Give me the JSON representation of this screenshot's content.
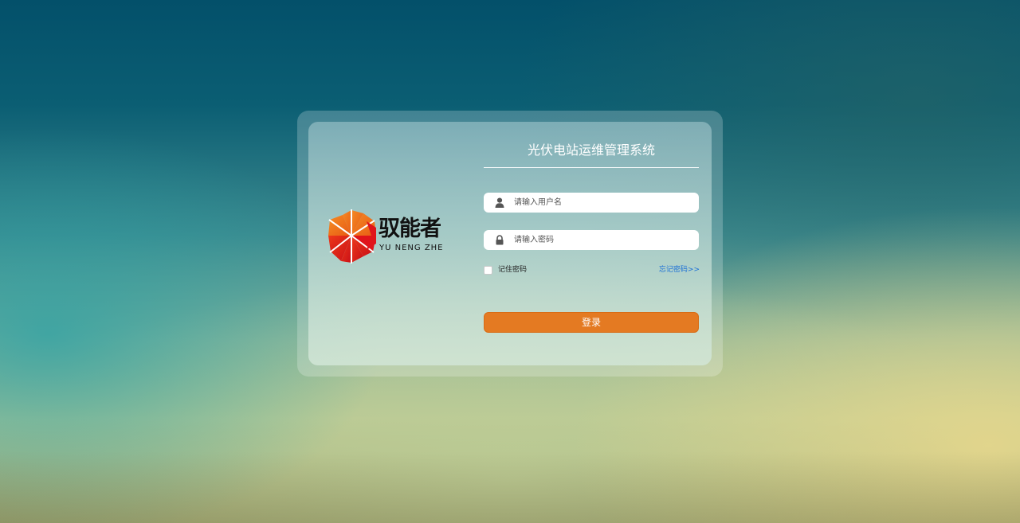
{
  "brand": {
    "name_cn": "驭能者",
    "name_en": "YU NENG ZHE"
  },
  "login": {
    "title": "光伏电站运维管理系统",
    "username": {
      "value": "",
      "placeholder": "请输入用户名",
      "icon": "user-icon"
    },
    "password": {
      "value": "",
      "placeholder": "请输入密码",
      "icon": "lock-icon"
    },
    "remember_label": "记住密码",
    "remember_checked": false,
    "forgot_link": "忘记密码>>",
    "submit_label": "登录"
  },
  "colors": {
    "accent": "#e47a22",
    "link": "#1a6fd6",
    "logo_orange": "#f07a1a",
    "logo_red": "#e0141b"
  }
}
